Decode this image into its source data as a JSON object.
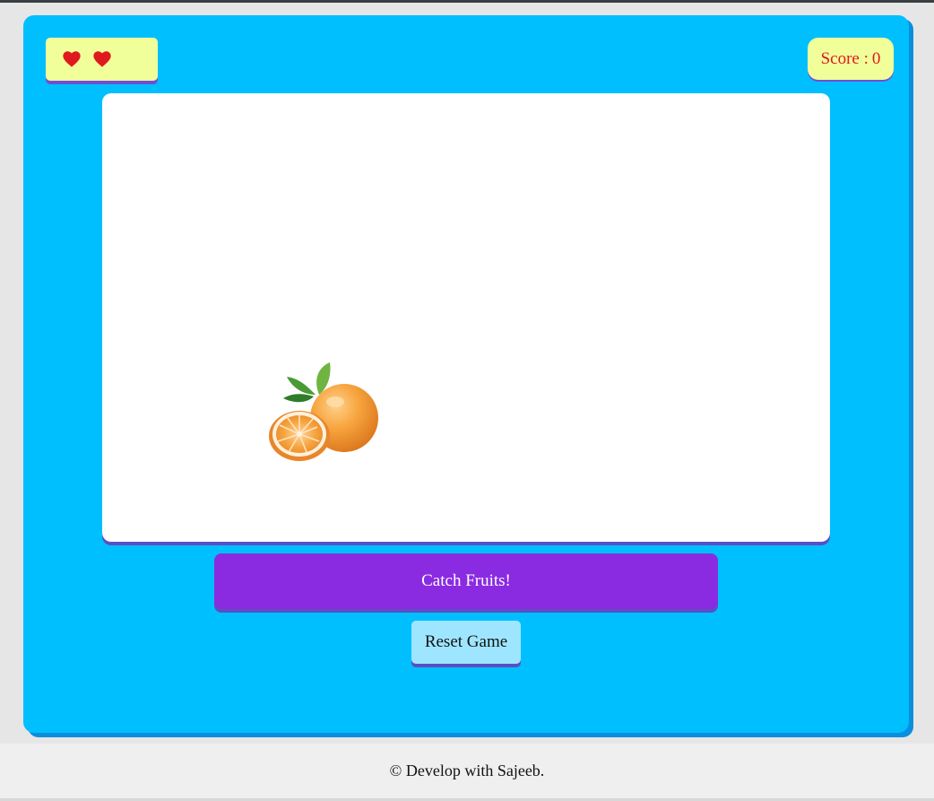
{
  "hud": {
    "lives": 2,
    "score_label": "Score :",
    "score_value": "0"
  },
  "game": {
    "fruit": "orange-icon"
  },
  "controls": {
    "catch_label": "Catch Fruits!",
    "reset_label": "Reset Game"
  },
  "footer": {
    "credit": "© Develop with Sajeeb."
  },
  "colors": {
    "panel": "#00bfff",
    "hud_box": "#f0ff99",
    "heart": "#e0191e",
    "catch_button": "#8a2be2",
    "reset_button": "#9ee6ff"
  }
}
